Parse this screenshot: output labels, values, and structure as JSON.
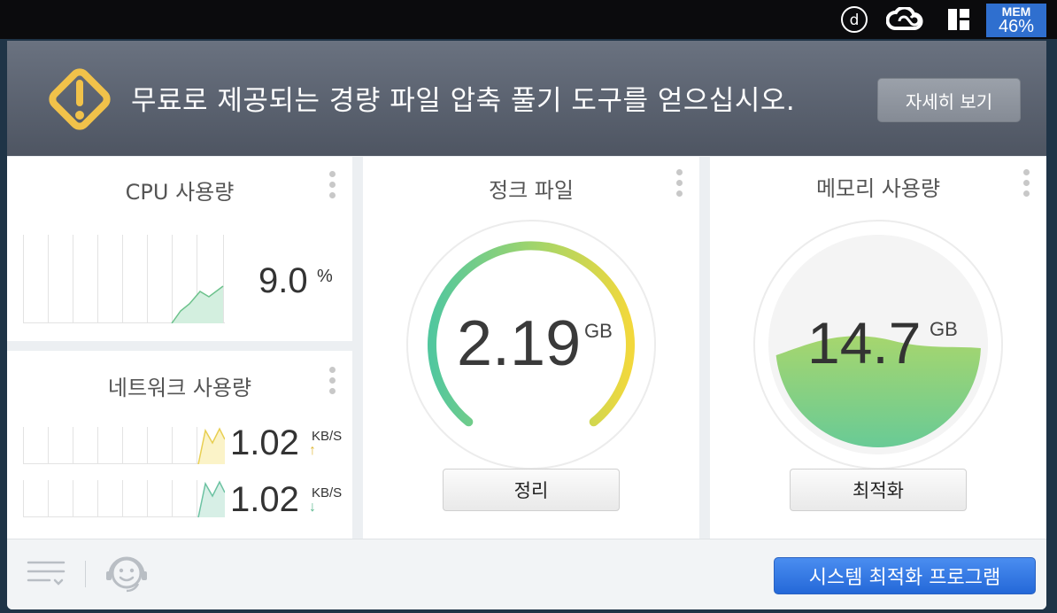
{
  "menubar": {
    "icons": [
      "d-circle-icon",
      "creative-cloud-icon",
      "window-grid-icon"
    ],
    "mem_label": "MEM",
    "mem_value": "46%"
  },
  "banner": {
    "icon": "warning-diamond-icon",
    "text": "무료로 제공되는 경량 파일 압축 풀기 도구를 얻으십시오.",
    "button": "자세히 보기"
  },
  "cpu": {
    "title": "CPU 사용량",
    "value": "9.0",
    "unit": "%"
  },
  "network": {
    "title": "네트워크 사용량",
    "upload_value": "1.02",
    "upload_unit": "KB/S",
    "upload_arrow": "↑",
    "download_value": "1.02",
    "download_unit": "KB/S",
    "download_arrow": "↓"
  },
  "junk": {
    "title": "정크 파일",
    "value": "2.19",
    "unit": "GB",
    "button": "정리"
  },
  "memory": {
    "title": "메모리 사용량",
    "value": "14.7",
    "unit": "GB",
    "button": "최적화"
  },
  "footer": {
    "icons": [
      "menu-list-icon",
      "support-face-icon"
    ],
    "button": "시스템 최적화 프로그램"
  },
  "colors": {
    "accent_blue": "#2f6fcf",
    "gauge_green": "#5cc89a",
    "gauge_yellow": "#f0d840",
    "warning_gold": "#f1c24a"
  }
}
